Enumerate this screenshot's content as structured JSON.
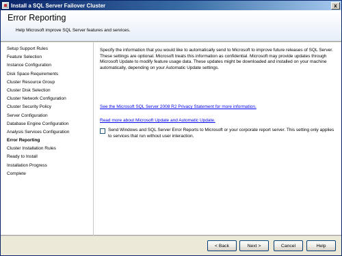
{
  "window": {
    "title": "Install a SQL Server Failover Cluster",
    "close_glyph": "x"
  },
  "header": {
    "title": "Error Reporting",
    "subtitle": "Help Microsoft improve SQL Server features and services."
  },
  "sidebar": {
    "items": [
      {
        "label": "Setup Support Rules"
      },
      {
        "label": "Feature Selection"
      },
      {
        "label": "Instance Configuration"
      },
      {
        "label": "Disk Space Requirements"
      },
      {
        "label": "Cluster Resource Group"
      },
      {
        "label": "Cluster Disk Selection"
      },
      {
        "label": "Cluster Network Configuration"
      },
      {
        "label": "Cluster Security Policy"
      },
      {
        "label": "Server Configuration"
      },
      {
        "label": "Database Engine Configuration"
      },
      {
        "label": "Analysis Services Configuration"
      },
      {
        "label": "Error Reporting"
      },
      {
        "label": "Cluster Installation Rules"
      },
      {
        "label": "Ready to Install"
      },
      {
        "label": "Installation Progress"
      },
      {
        "label": "Complete"
      }
    ],
    "active_label": "Error Reporting"
  },
  "main": {
    "description": "Specify the information that you would like to automatically send to Microsoft to improve future releases of SQL Server. These settings are optional. Microsoft treats this information as confidential. Microsoft may provide updates through Microsoft Update to modify feature usage data. These updates might be downloaded and installed on your machine automatically, depending on your Automatic Update settings.",
    "privacy_link": "See the Microsoft SQL Server 2008 R2 Privacy Statement for more information.",
    "update_link": "Read more about Microsoft Update and Automatic Update.",
    "error_reports_checkbox": {
      "label": "Send Windows and SQL Server Error Reports to Microsoft or your corporate report server. This setting only applies to services that run without user interaction.",
      "checked": false
    }
  },
  "footer": {
    "back_label": "< Back",
    "next_label": "Next >",
    "cancel_label": "Cancel",
    "help_label": "Help"
  },
  "colors": {
    "link": "#0000ee",
    "title_bar": "#0a246a",
    "button_border": "#003c74"
  }
}
